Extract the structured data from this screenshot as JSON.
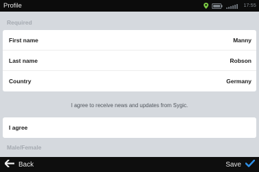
{
  "statusbar": {
    "title": "Profile",
    "time": "17:55",
    "icons": [
      "gps-icon",
      "battery-icon",
      "signal-icon"
    ]
  },
  "sections": {
    "required": "Required",
    "male_female": "Male/Female"
  },
  "fields": [
    {
      "label": "First name",
      "value": "Manny"
    },
    {
      "label": "Last name",
      "value": "Robson"
    },
    {
      "label": "Country",
      "value": "Germany"
    }
  ],
  "consent": {
    "text": "I agree to receive news and updates from Sygic.",
    "option_label": "I agree"
  },
  "bottom": {
    "back_label": "Back",
    "save_label": "Save"
  },
  "colors": {
    "background": "#d5d9de",
    "bar": "#0e0e0e",
    "accent_check": "#2f8fe6",
    "gps_green": "#7ac943"
  }
}
